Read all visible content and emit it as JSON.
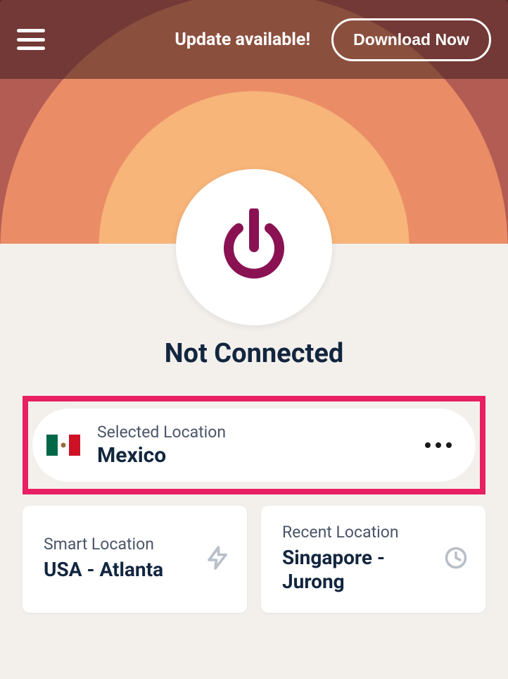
{
  "topbar": {
    "update_text": "Update available!",
    "download_label": "Download Now"
  },
  "status_text": "Not Connected",
  "selected": {
    "label": "Selected Location",
    "value": "Mexico"
  },
  "smart": {
    "label": "Smart Location",
    "value": "USA - Atlanta"
  },
  "recent": {
    "label": "Recent Location",
    "value": "Singapore - Jurong"
  },
  "colors": {
    "highlight": "#e81f63",
    "power": "#8a1253"
  }
}
